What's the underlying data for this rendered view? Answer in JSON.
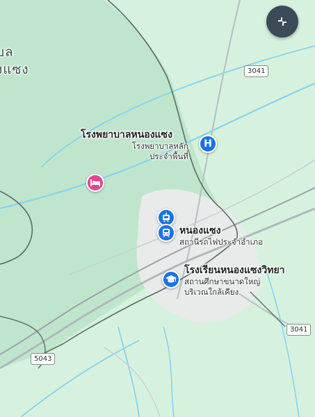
{
  "map": {
    "district_label_line1": "บล",
    "district_label_line2": "งแซง",
    "hospital": {
      "title": "โรงพยาบาลหนองแซง",
      "sub_line1": "โรงพยาบาลหลัก",
      "sub_line2": "ประจำพื้นที่",
      "icon": "hospital-icon",
      "color": "#1a73e8"
    },
    "lodging": {
      "icon": "bed-icon",
      "color": "#e8458f"
    },
    "station": {
      "title": "หนองแซง",
      "sub": "สถานีรถไฟประจำอำเภอ",
      "icons": [
        "tram-icon",
        "train-icon"
      ],
      "color": "#1a73e8"
    },
    "school": {
      "title": "โรงเรียนหนองแซงวิทยา",
      "sub_line1": "สถานศึกษาขนาดใหญ่",
      "sub_line2": "บริเวณใกล้เคียง",
      "icon": "graduation-cap-icon",
      "color": "#1a73e8"
    },
    "road_shields": {
      "top": "3041",
      "right": "3041",
      "bottom_left": "5043"
    },
    "collapse_button": {
      "icon": "collapse-icon"
    },
    "colors": {
      "land": "#d4f0dc",
      "district_area": "#bfe6cc",
      "town": "#e9eceb",
      "water": "#7fd0ec",
      "road": "#b7c0c5",
      "boundary": "#5f6b66"
    }
  }
}
